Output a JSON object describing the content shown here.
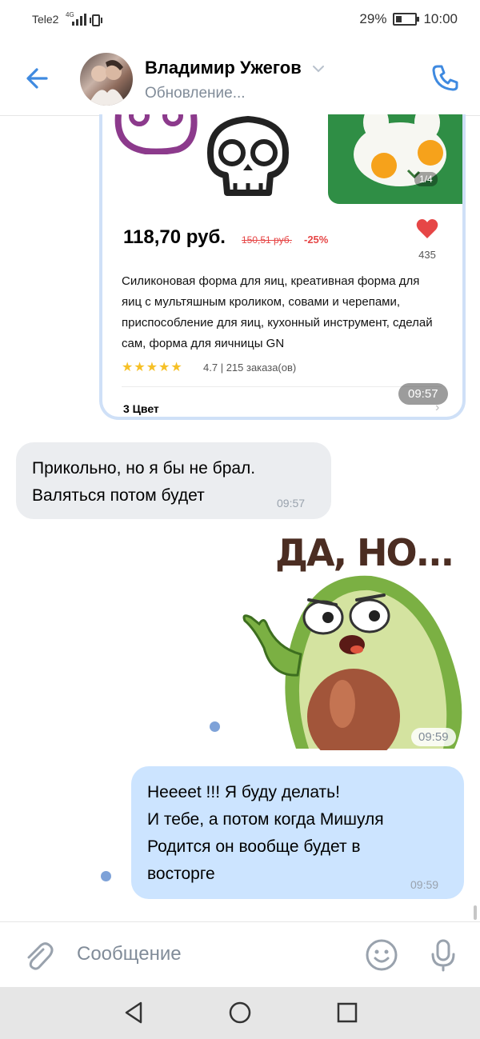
{
  "status_bar": {
    "carrier": "Tele2",
    "network": "4G",
    "battery": "29%",
    "time": "10:00"
  },
  "header": {
    "contact_name": "Владимир Ужегов",
    "status": "Обновление..."
  },
  "product_card": {
    "image_counter": "1/4",
    "price": "118,70 руб.",
    "old_price": "150,51 руб.",
    "discount": "-25%",
    "likes": "435",
    "description": "Силиконовая форма для яиц, креативная форма для яиц с мультяшным кроликом, совами и черепами, приспособление для яиц, кухонный инструмент, сделай сам, форма для яичницы GN",
    "rating": "4.7",
    "orders": "215 заказа(ов)",
    "colors": "3 Цвет",
    "time": "09:57"
  },
  "messages": [
    {
      "direction": "in",
      "text": "Прикольно, но я бы не брал.\nВаляться потом будет",
      "time": "09:57"
    },
    {
      "direction": "out",
      "type": "sticker",
      "sticker_text": "ДА, НО...",
      "time": "09:59"
    },
    {
      "direction": "out",
      "text": "Нееееt !!! Я буду делать!\nИ тебе, а потом когда Мишуля\nРодится он вообще будет в\nвосторге",
      "time": "09:59"
    }
  ],
  "input": {
    "placeholder": "Сообщение"
  },
  "colors": {
    "accent": "#3f8ae0",
    "incoming_bubble": "#ebedf0",
    "outgoing_bubble": "#cce4ff",
    "price_red": "#e64646"
  }
}
